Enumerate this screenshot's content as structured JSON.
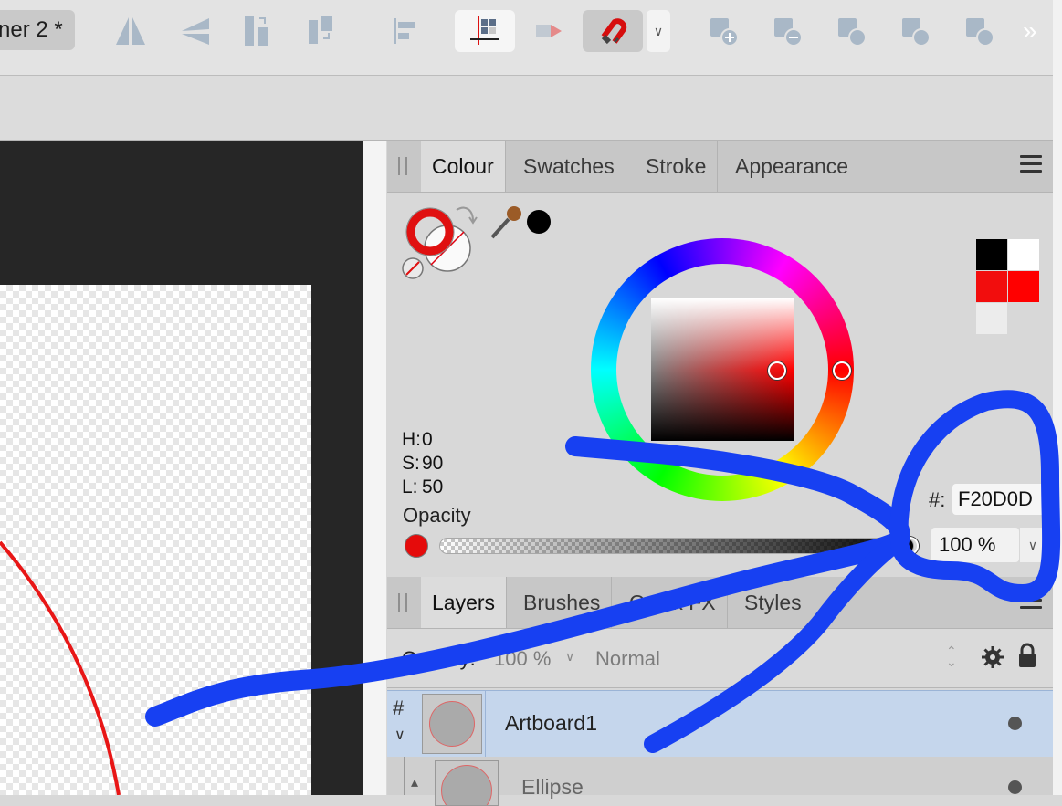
{
  "toolbar": {
    "doc_tab": "ner 2 *",
    "more_label": "»",
    "icons": [
      "flip-horizontal",
      "flip-vertical",
      "align-to-selection",
      "align-to-key",
      "align-left",
      "snapping-grid",
      "snapping-toggle",
      "snapping-magnet",
      "snapping-options",
      "add-shapes",
      "subtract-shapes",
      "intersect-shapes",
      "xor-shapes",
      "divide-shapes",
      "more"
    ]
  },
  "colour_panel": {
    "tabs": [
      "Colour",
      "Swatches",
      "Stroke",
      "Appearance"
    ],
    "active_tab": "Colour",
    "hsl": {
      "h_label": "H:",
      "h": "0",
      "s_label": "S:",
      "s": "90",
      "l_label": "L:",
      "l": "50"
    },
    "opacity_label": "Opacity",
    "opacity_value": "100 %",
    "hex_label": "#:",
    "hex_value": "F20D0D",
    "fill_color": "#f20d0d",
    "recent_swatches": [
      "#000000",
      "#ffffff",
      "#f20d0d",
      "#ff0000",
      "#eeeeee"
    ]
  },
  "layers_panel": {
    "tabs": [
      "Layers",
      "Brushes",
      "Quick FX",
      "Styles"
    ],
    "active_tab": "Layers",
    "opacity_label": "Opacity:",
    "opacity_value": "100 %",
    "blend_mode": "Normal",
    "layers": [
      {
        "name": "Artboard1",
        "selected": true
      },
      {
        "name": "Ellipse",
        "selected": false
      }
    ]
  }
}
